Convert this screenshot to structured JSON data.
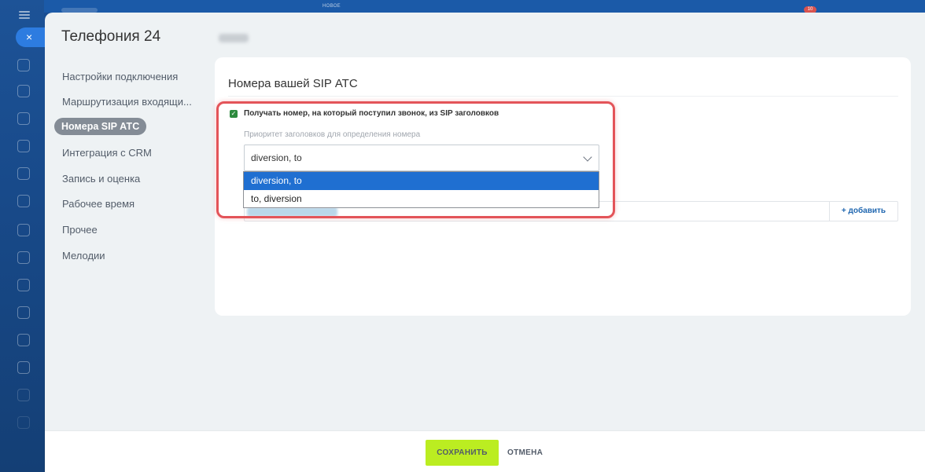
{
  "topbar": {
    "label": "НОВОЕ",
    "badge": "10"
  },
  "close_icon": "×",
  "page": {
    "title": "Телефония 24"
  },
  "menu": {
    "items": [
      {
        "label": "Настройки подключения",
        "active": false
      },
      {
        "label": "Маршрутизация входящи...",
        "active": false
      },
      {
        "label": "Номера SIP АТС",
        "active": true
      },
      {
        "label": "Интеграция с CRM",
        "active": false
      },
      {
        "label": "Запись и оценка",
        "active": false
      },
      {
        "label": "Рабочее время",
        "active": false
      },
      {
        "label": "Прочее",
        "active": false
      },
      {
        "label": "Мелодии",
        "active": false
      }
    ]
  },
  "card": {
    "title": "Номера вашей SIP АТС",
    "checkbox_label": "Получать номер, на который поступил звонок, из SIP заголовков",
    "checkbox_checked": true,
    "field_label": "Приоритет заголовков для определения номера",
    "select_value": "diversion, to",
    "options": [
      {
        "label": "diversion, to",
        "selected": true
      },
      {
        "label": "to, diversion",
        "selected": false
      }
    ],
    "add_label": "+ добавить"
  },
  "footer": {
    "save_label": "СОХРАНИТЬ",
    "cancel_label": "ОТМЕНА"
  },
  "colors": {
    "accent_save": "#bbed21",
    "highlight": "#e35459",
    "selected_option": "#1f6fd1",
    "checkbox": "#2d8a3e"
  }
}
